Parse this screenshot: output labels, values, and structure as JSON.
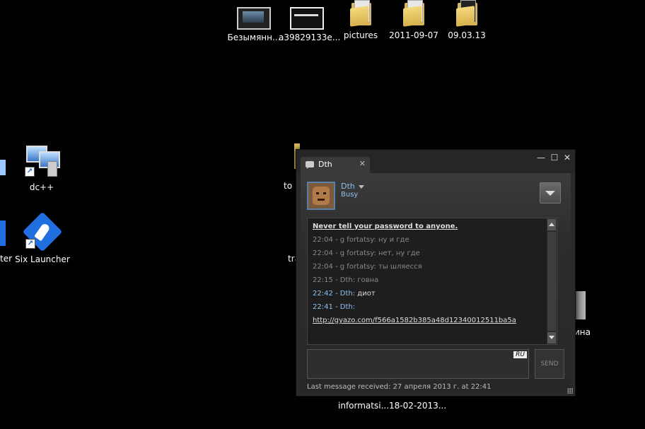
{
  "desktop_icons": {
    "top": [
      "Безымянн...",
      "a39829133e...",
      "pictures",
      "2011-09-07",
      "09.03.13"
    ],
    "dcpp": "dc++",
    "six_launcher": "Six Launcher",
    "partial_left": "ter",
    "partial_to": "to",
    "partial_tra": "tra",
    "partial_recycle": "ина",
    "bottom": [
      "informatsi...",
      "18-02-2013..."
    ]
  },
  "chat": {
    "tab_title": "Dth",
    "tab_close": "✕",
    "window_controls": {
      "minimize": "—",
      "maximize": "☐",
      "close": "✕"
    },
    "profile": {
      "name": "Dth",
      "status": "Busy"
    },
    "log": {
      "warning": "Never tell your password to anyone.",
      "messages": [
        {
          "meta": "22:04 - g fortatsy:",
          "text": " ну и где"
        },
        {
          "meta": "22:04 - g fortatsy:",
          "text": " нет, ну где"
        },
        {
          "meta": "22:04 - g fortatsy:",
          "text": " ты шляесся"
        },
        {
          "meta": "22:15 - Dth:",
          "text": " говна"
        },
        {
          "meta": "22:42 - Dth:",
          "text": " диот"
        },
        {
          "meta": "22:41 - Dth:",
          "text": ""
        }
      ],
      "link": "http://gyazo.com/f566a1582b385a48d12340012511ba5a"
    },
    "input": {
      "language": "RU",
      "value": ""
    },
    "send_label": "SEND",
    "last_message": "Last message received: 27 апреля 2013 г. at 22:41"
  },
  "colors": {
    "desktop_bg": "#000000",
    "accent_blue": "#8ec0ef",
    "chat_bg": "#2a2a2a"
  }
}
